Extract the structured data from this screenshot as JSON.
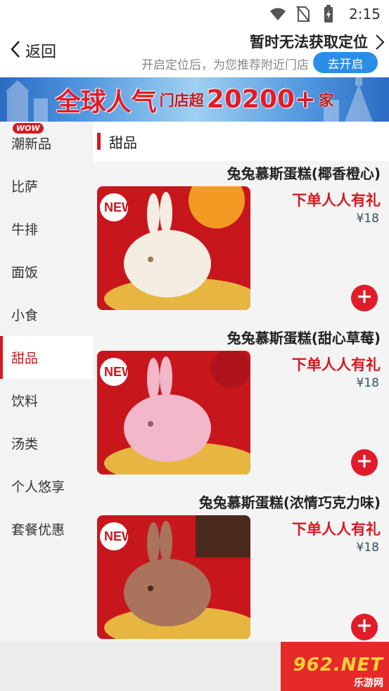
{
  "status_bar": {
    "time": "2:15"
  },
  "header": {
    "back_label": "返回",
    "location_title": "暂时无法获取定位",
    "location_hint": "开启定位后，为您推荐附近门店",
    "enable_button": "去开启"
  },
  "banner": {
    "big_text": "全球人气",
    "small_text_1": "门店超",
    "number": "20200+",
    "small_text_2": "家"
  },
  "sidebar": {
    "badge": "WOW",
    "items": [
      {
        "label": "潮新品"
      },
      {
        "label": "比萨"
      },
      {
        "label": "牛排"
      },
      {
        "label": "面饭"
      },
      {
        "label": "小食"
      },
      {
        "label": "甜品"
      },
      {
        "label": "饮料"
      },
      {
        "label": "汤类"
      },
      {
        "label": "个人悠享"
      },
      {
        "label": "套餐优惠"
      }
    ],
    "active_label": "甜品"
  },
  "section": {
    "title": "甜品"
  },
  "products": [
    {
      "name": "兔兔慕斯蛋糕(椰香橙心)",
      "promo": "下单人人有礼",
      "price": "¥18",
      "new_tag": "NEW",
      "color": "#f4eee2"
    },
    {
      "name": "兔兔慕斯蛋糕(甜心草莓)",
      "promo": "下单人人有礼",
      "price": "¥18",
      "new_tag": "NEW",
      "color": "#f2b7c8"
    },
    {
      "name": "兔兔慕斯蛋糕(浓情巧克力味)",
      "promo": "下单人人有礼",
      "price": "¥18",
      "new_tag": "NEW",
      "color": "#a9735c"
    }
  ],
  "watermark": {
    "top": "962.NET",
    "bottom": "乐游网"
  },
  "colors": {
    "accent": "#d31a22",
    "button_blue": "#2a8ee8"
  }
}
